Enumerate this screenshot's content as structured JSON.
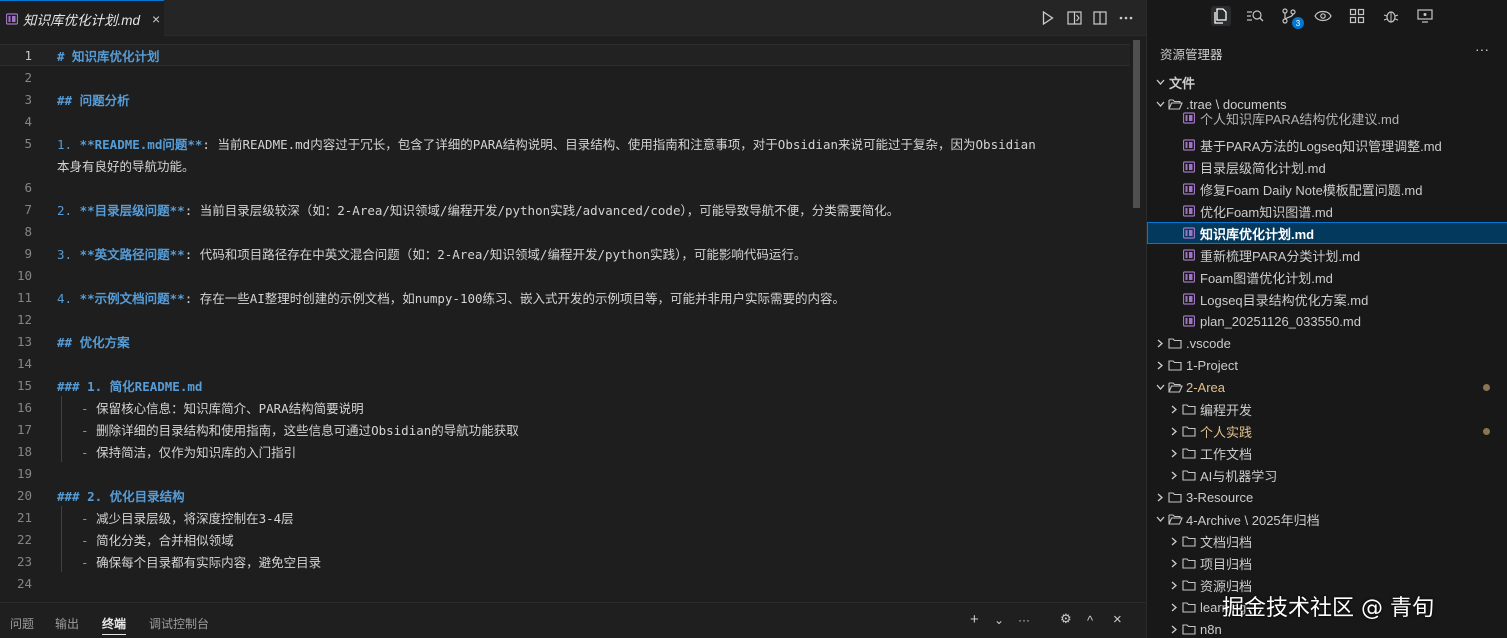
{
  "editor": {
    "tab": {
      "label": "知识库优化计划.md",
      "close": "×"
    },
    "actions": [
      "run-icon",
      "open-preview-side-icon",
      "split-editor-icon",
      "more-actions-icon"
    ],
    "current_line": 1,
    "lines": [
      {
        "n": "1",
        "parts": [
          [
            "h",
            "# 知识库优化计划"
          ]
        ]
      },
      {
        "n": "2",
        "parts": []
      },
      {
        "n": "3",
        "parts": [
          [
            "h",
            "## 问题分析"
          ]
        ]
      },
      {
        "n": "4",
        "parts": []
      },
      {
        "n": "5",
        "parts": [
          [
            "num",
            "1. "
          ],
          [
            "bold",
            "**README.md问题**"
          ],
          [
            "t",
            ": 当前README.md内容过于冗长，包含了详细的PARA结构说明、目录结构、使用指南和注意事项，对于Obsidian来说可能过于复杂，因为Obsidian"
          ]
        ]
      },
      {
        "n": "",
        "parts": [
          [
            "t",
            "本身有良好的导航功能。"
          ]
        ]
      },
      {
        "n": "6",
        "parts": []
      },
      {
        "n": "7",
        "parts": [
          [
            "num",
            "2. "
          ],
          [
            "bold",
            "**目录层级问题**"
          ],
          [
            "t",
            ": 当前目录层级较深（如：2-Area/知识领域/编程开发/python实践/advanced/code），可能导致导航不便，分类需要简化。"
          ]
        ]
      },
      {
        "n": "8",
        "parts": []
      },
      {
        "n": "9",
        "parts": [
          [
            "num",
            "3. "
          ],
          [
            "bold",
            "**英文路径问题**"
          ],
          [
            "t",
            ": 代码和项目路径存在中英文混合问题（如：2-Area/知识领域/编程开发/python实践），可能影响代码运行。"
          ]
        ]
      },
      {
        "n": "10",
        "parts": []
      },
      {
        "n": "11",
        "parts": [
          [
            "num",
            "4. "
          ],
          [
            "bold",
            "**示例文档问题**"
          ],
          [
            "t",
            ": 存在一些AI整理时创建的示例文档，如numpy-100练习、嵌入式开发的示例项目等，可能并非用户实际需要的内容。"
          ]
        ]
      },
      {
        "n": "12",
        "parts": []
      },
      {
        "n": "13",
        "parts": [
          [
            "h",
            "## 优化方案"
          ]
        ]
      },
      {
        "n": "14",
        "parts": []
      },
      {
        "n": "15",
        "parts": [
          [
            "h",
            "### 1. 简化README.md"
          ]
        ]
      },
      {
        "n": "16",
        "indent": true,
        "parts": [
          [
            "dash",
            "- "
          ],
          [
            "t",
            "保留核心信息：知识库简介、PARA结构简要说明"
          ]
        ]
      },
      {
        "n": "17",
        "indent": true,
        "parts": [
          [
            "dash",
            "- "
          ],
          [
            "t",
            "删除详细的目录结构和使用指南，这些信息可通过Obsidian的导航功能获取"
          ]
        ]
      },
      {
        "n": "18",
        "indent": true,
        "parts": [
          [
            "dash",
            "- "
          ],
          [
            "t",
            "保持简洁，仅作为知识库的入门指引"
          ]
        ]
      },
      {
        "n": "19",
        "parts": []
      },
      {
        "n": "20",
        "parts": [
          [
            "h",
            "### 2. 优化目录结构"
          ]
        ]
      },
      {
        "n": "21",
        "indent": true,
        "parts": [
          [
            "dash",
            "- "
          ],
          [
            "t",
            "减少目录层级，将深度控制在3-4层"
          ]
        ]
      },
      {
        "n": "22",
        "indent": true,
        "parts": [
          [
            "dash",
            "- "
          ],
          [
            "t",
            "简化分类，合并相似领域"
          ]
        ]
      },
      {
        "n": "23",
        "indent": true,
        "parts": [
          [
            "dash",
            "- "
          ],
          [
            "t",
            "确保每个目录都有实际内容，避免空目录"
          ]
        ]
      },
      {
        "n": "24",
        "parts": []
      }
    ]
  },
  "panel": {
    "tabs": [
      "问题",
      "输出",
      "终端",
      "调试控制台"
    ],
    "active_tab": "终端",
    "actions": [
      "+",
      "⌄",
      "···",
      "⚙",
      "^",
      "×"
    ]
  },
  "sidebar": {
    "activity_icons": [
      "explorer-icon",
      "search-icon",
      "source-control-icon",
      "preview-icon",
      "extensions-icon",
      "debug-icon",
      "remote-icon"
    ],
    "source_control_badge": "3",
    "title": "资源管理器",
    "more": "···",
    "section": "文件",
    "tree": [
      {
        "depth": 0,
        "type": "folder-open",
        "label": "文件",
        "section": true
      },
      {
        "depth": 0,
        "type": "folder-open",
        "label": ".trae \\ documents"
      },
      {
        "depth": 1,
        "type": "file",
        "label": "个人知识库PARA结构优化建议.md",
        "partial": true
      },
      {
        "depth": 1,
        "type": "file",
        "label": "基于PARA方法的Logseq知识管理调整.md"
      },
      {
        "depth": 1,
        "type": "file",
        "label": "目录层级简化计划.md"
      },
      {
        "depth": 1,
        "type": "file",
        "label": "修复Foam Daily Note模板配置问题.md"
      },
      {
        "depth": 1,
        "type": "file",
        "label": "优化Foam知识图谱.md"
      },
      {
        "depth": 1,
        "type": "file",
        "label": "知识库优化计划.md",
        "selected": true
      },
      {
        "depth": 1,
        "type": "file",
        "label": "重新梳理PARA分类计划.md"
      },
      {
        "depth": 1,
        "type": "file",
        "label": "Foam图谱优化计划.md"
      },
      {
        "depth": 1,
        "type": "file",
        "label": "Logseq目录结构优化方案.md"
      },
      {
        "depth": 1,
        "type": "file",
        "label": "plan_20251126_033550.md"
      },
      {
        "depth": 0,
        "type": "folder",
        "label": ".vscode"
      },
      {
        "depth": 0,
        "type": "folder",
        "label": "1-Project"
      },
      {
        "depth": 0,
        "type": "folder-open",
        "label": "2-Area",
        "modified": true
      },
      {
        "depth": 1,
        "type": "folder",
        "label": "编程开发"
      },
      {
        "depth": 1,
        "type": "folder",
        "label": "个人实践",
        "modified": true
      },
      {
        "depth": 1,
        "type": "folder",
        "label": "工作文档"
      },
      {
        "depth": 1,
        "type": "folder",
        "label": "AI与机器学习"
      },
      {
        "depth": 0,
        "type": "folder",
        "label": "3-Resource"
      },
      {
        "depth": 0,
        "type": "folder-open",
        "label": "4-Archive \\ 2025年归档"
      },
      {
        "depth": 1,
        "type": "folder",
        "label": "文档归档"
      },
      {
        "depth": 1,
        "type": "folder",
        "label": "项目归档"
      },
      {
        "depth": 1,
        "type": "folder",
        "label": "资源归档"
      },
      {
        "depth": 1,
        "type": "folder",
        "label": "learning-"
      },
      {
        "depth": 1,
        "type": "folder",
        "label": "n8n"
      }
    ]
  },
  "watermark": "掘金技术社区 @ 青旬"
}
